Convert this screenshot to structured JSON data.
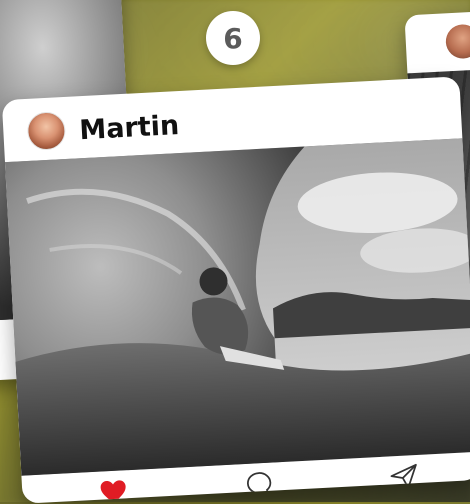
{
  "post": {
    "rank": "6",
    "username": "Martin"
  },
  "colors": {
    "like_active": "#e01c24",
    "icon_stroke": "#333333"
  },
  "icons": [
    "heart-icon",
    "comment-icon",
    "share-icon"
  ]
}
